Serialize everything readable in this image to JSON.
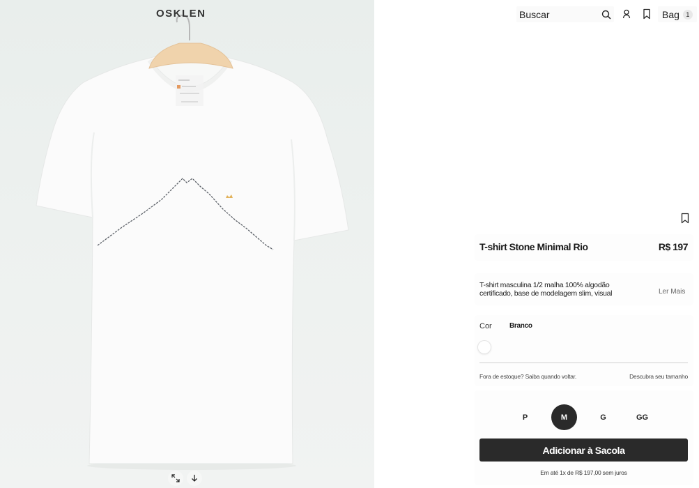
{
  "brand": {
    "logo_text": "OSKLEN",
    "hanger_text": "OSKLEN"
  },
  "header": {
    "search_placeholder": "Buscar",
    "bag_label": "Bag",
    "bag_count": "1",
    "icons": [
      "search-icon",
      "user-icon",
      "bookmark-icon"
    ]
  },
  "product": {
    "title": "T-shirt Stone Minimal Rio",
    "price": "R$ 197",
    "description": "T-shirt masculina 1/2 malha 100% algodão certificado, base de modelagem slim, visual",
    "read_more": "Ler Mais",
    "color_label": "Cor",
    "color_value": "Branco",
    "swatch_color": "#ffffff",
    "out_of_stock_text": "Fora de estoque? Saiba quando voltar.",
    "size_guide": "Descubra seu tamanho",
    "sizes": [
      "P",
      "M",
      "G",
      "GG"
    ],
    "selected_size": "M",
    "add_to_bag": "Adicionar à Sacola",
    "installments": "Em até 1x de R$ 197,00 sem juros"
  },
  "gallery": {
    "icons": [
      "expand-icon",
      "arrow-down-icon"
    ]
  },
  "colors": {
    "accent": "#2a2a2a",
    "panel_bg": "#fdfdfd",
    "gallery_bg": "#ecf0ee"
  }
}
